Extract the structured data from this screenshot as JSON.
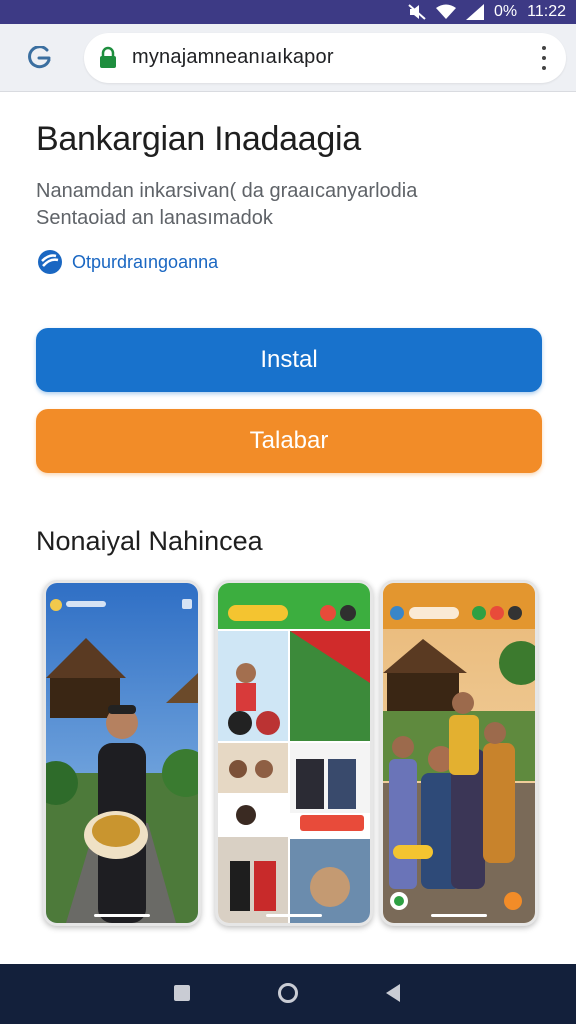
{
  "status_bar": {
    "battery": "0%",
    "time": "11:22"
  },
  "browser": {
    "url": "mynajamneanıaıkapor"
  },
  "app": {
    "title": "Bankargian Inadaagia",
    "description_line1": "Nanamdan inkarsivan( da graaıcanyarlodia",
    "description_line2": "Sentaoiad an lanasımadok",
    "developer": "Otpurdraıngoanna"
  },
  "buttons": {
    "install": "Instal",
    "secondary": "Talabar"
  },
  "screenshots_section": {
    "title": "Nonaiyal Nahincea"
  },
  "colors": {
    "install": "#1872cc",
    "secondary": "#f28c28",
    "status_bar": "#3d3a85",
    "nav_bar": "#13203b"
  }
}
